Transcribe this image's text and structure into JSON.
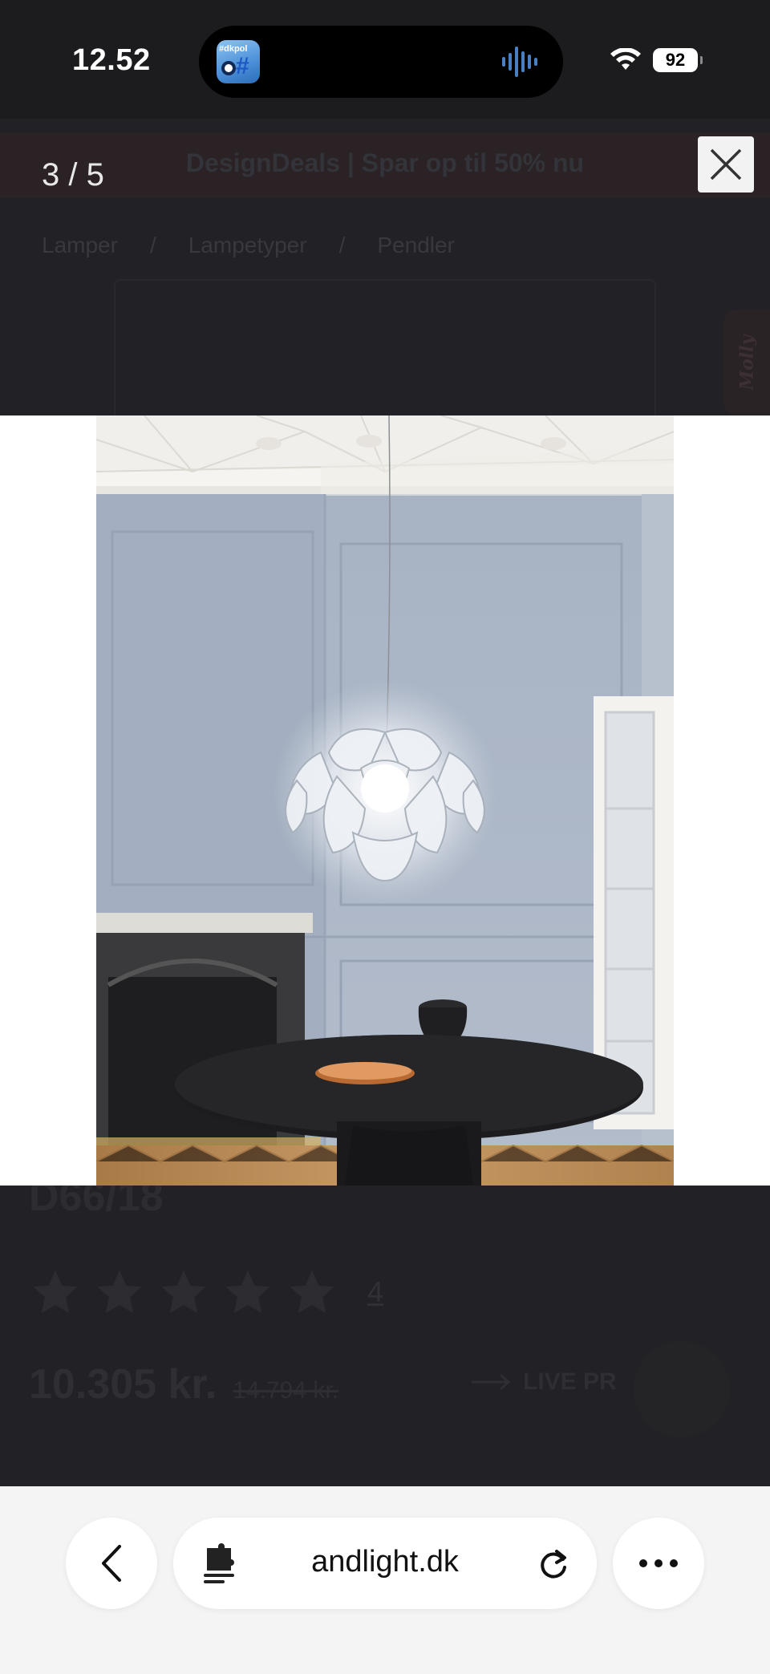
{
  "status_bar": {
    "time": "12.52",
    "island_app_tag": "#dkpol",
    "battery": "92"
  },
  "background_page": {
    "promo": "DesignDeals | Spar op til 50% nu",
    "breadcrumb": [
      "Lamper",
      "Lampetyper",
      "Pendler"
    ],
    "molly_tab": "Molly",
    "product_code": "D66/18",
    "rating_stars": 5,
    "review_count": "4",
    "price": "10.305 kr.",
    "old_price": "14.794 kr.",
    "live_label": "LIVE PR"
  },
  "viewer": {
    "counter": "3 / 5",
    "current_index": 3,
    "total_images": 5
  },
  "browser": {
    "url": "andlight.dk"
  },
  "colors": {
    "wall": "#a9b5c6",
    "ceiling": "#f2f0ec",
    "floor": "#b98a58",
    "table": "#1d1d1f",
    "plate": "#d8894f"
  }
}
